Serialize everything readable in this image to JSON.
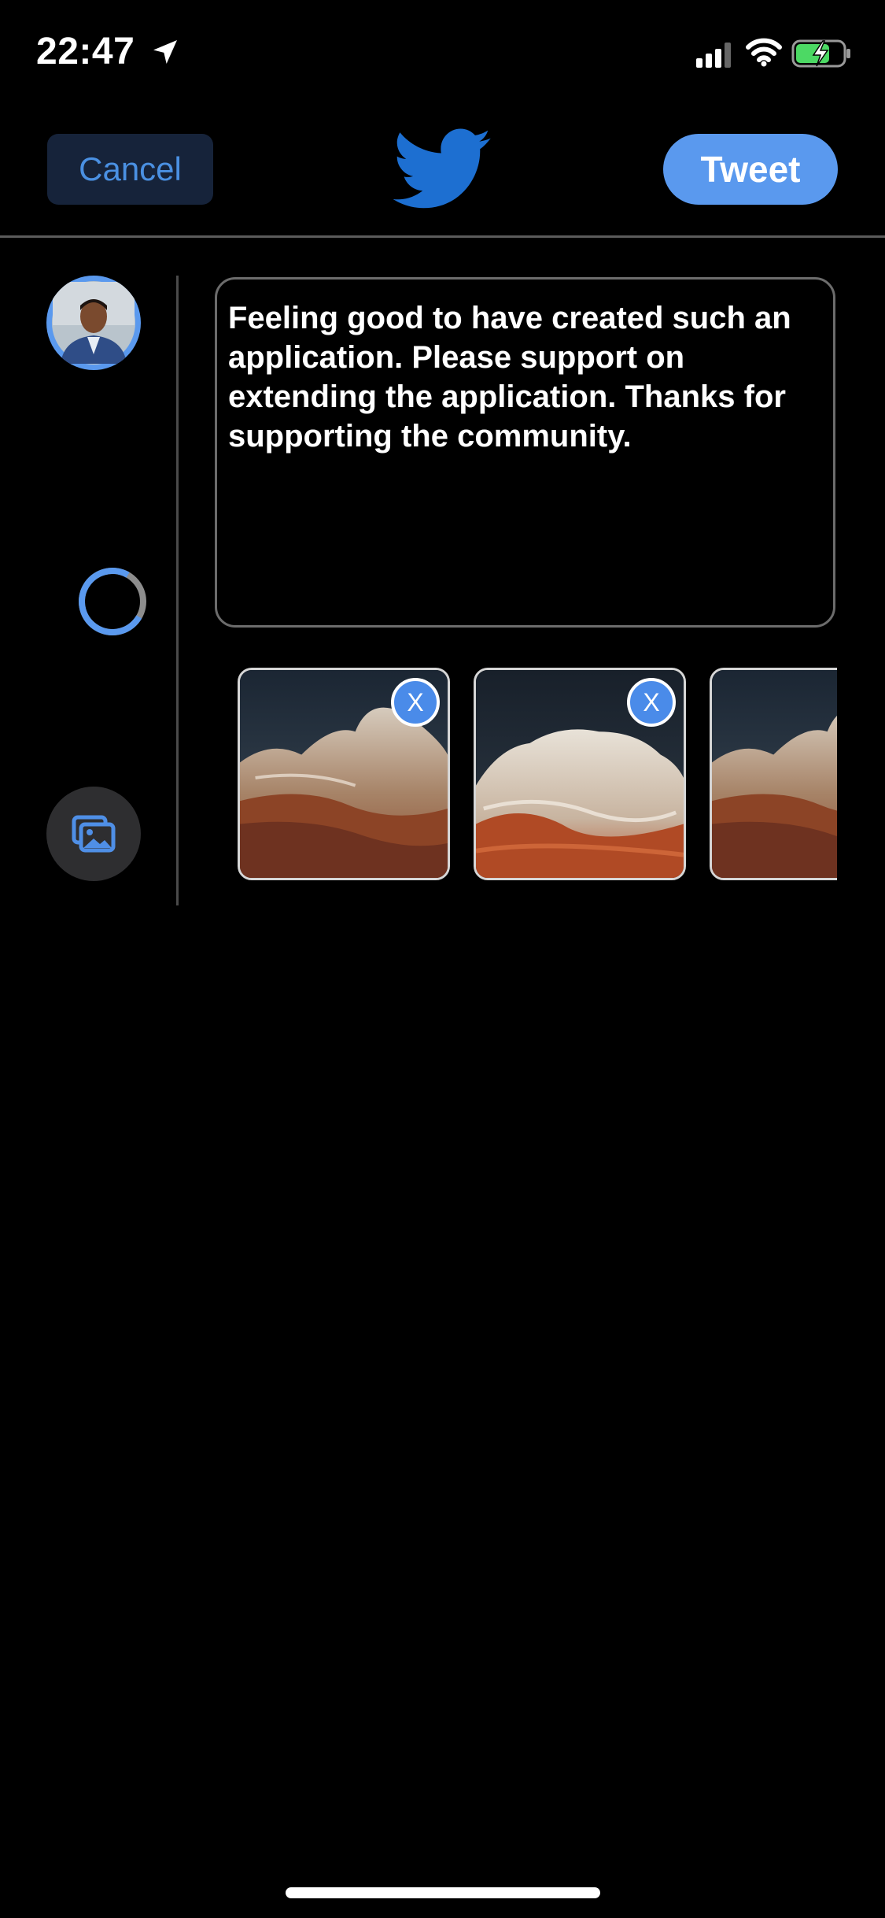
{
  "status_bar": {
    "time": "22:47",
    "icons": [
      "location-arrow-icon",
      "cellular-signal-icon",
      "wifi-icon",
      "battery-charging-icon"
    ]
  },
  "header": {
    "cancel_label": "Cancel",
    "logo_icon": "twitter-bird-icon",
    "tweet_label": "Tweet"
  },
  "compose": {
    "text": "Feeling good to have created such an application. Please support on extending the application. Thanks for supporting the community.",
    "media_button_icon": "photo-library-icon",
    "character_progress_icon": "character-count-ring"
  },
  "media": {
    "items": [
      {
        "remove_label": "X"
      },
      {
        "remove_label": "X"
      },
      {
        "remove_label": ""
      }
    ]
  },
  "colors": {
    "accent": "#5a99ee",
    "background": "#000000",
    "cancel_bg": "#16233a"
  }
}
